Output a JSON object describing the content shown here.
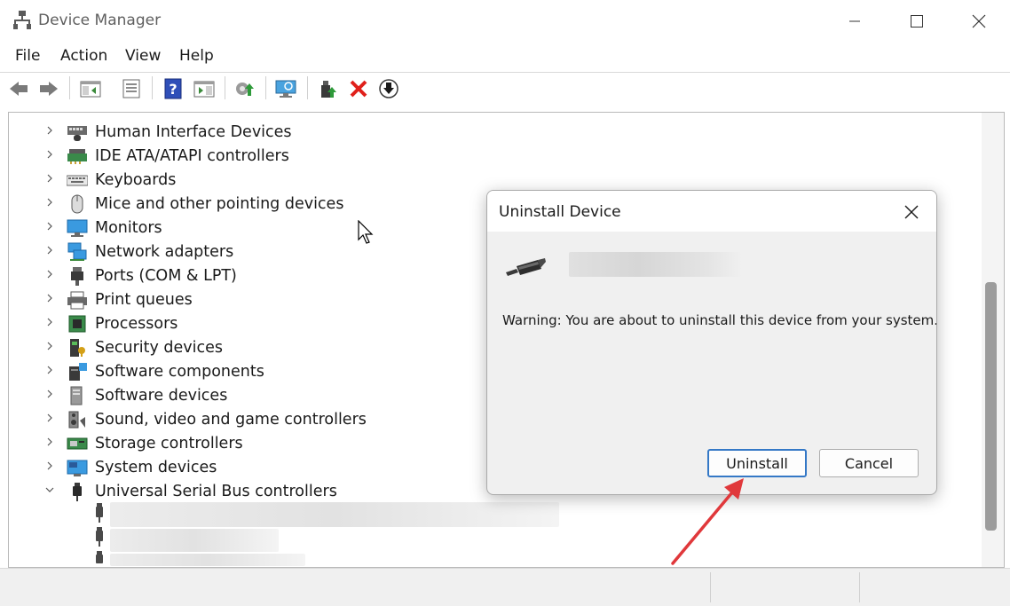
{
  "window": {
    "title": "Device Manager",
    "controls": {
      "minimize": "minimize-icon",
      "maximize": "maximize-icon",
      "close": "close-icon"
    }
  },
  "menu": [
    "File",
    "Action",
    "View",
    "Help"
  ],
  "toolbar": [
    "back-arrow-icon",
    "forward-arrow-icon",
    "show-hide-console-tree-icon",
    "properties-icon",
    "help-icon",
    "action-pane-icon",
    "update-driver-icon",
    "scan-hardware-icon",
    "enable-device-icon",
    "uninstall-device-icon",
    "disable-device-icon"
  ],
  "tree": {
    "items": [
      {
        "label": "Human Interface Devices",
        "icon": "hid-icon",
        "expanded": false
      },
      {
        "label": "IDE ATA/ATAPI controllers",
        "icon": "ide-controller-icon",
        "expanded": false
      },
      {
        "label": "Keyboards",
        "icon": "keyboard-icon",
        "expanded": false
      },
      {
        "label": "Mice and other pointing devices",
        "icon": "mouse-icon",
        "expanded": false
      },
      {
        "label": "Monitors",
        "icon": "monitor-icon",
        "expanded": false
      },
      {
        "label": "Network adapters",
        "icon": "network-adapter-icon",
        "expanded": false
      },
      {
        "label": "Ports (COM & LPT)",
        "icon": "port-icon",
        "expanded": false
      },
      {
        "label": "Print queues",
        "icon": "printer-icon",
        "expanded": false
      },
      {
        "label": "Processors",
        "icon": "processor-icon",
        "expanded": false
      },
      {
        "label": "Security devices",
        "icon": "security-device-icon",
        "expanded": false
      },
      {
        "label": "Software components",
        "icon": "software-component-icon",
        "expanded": false
      },
      {
        "label": "Software devices",
        "icon": "software-device-icon",
        "expanded": false
      },
      {
        "label": "Sound, video and game controllers",
        "icon": "speaker-icon",
        "expanded": false
      },
      {
        "label": "Storage controllers",
        "icon": "storage-controller-icon",
        "expanded": false
      },
      {
        "label": "System devices",
        "icon": "system-device-icon",
        "expanded": false
      },
      {
        "label": "Universal Serial Bus controllers",
        "icon": "usb-icon",
        "expanded": true
      }
    ]
  },
  "dialog": {
    "title": "Uninstall Device",
    "device_icon": "usb-cable-icon",
    "warning": "Warning: You are about to uninstall this device from your system.",
    "uninstall_label": "Uninstall",
    "cancel_label": "Cancel"
  },
  "colors": {
    "accent": "#3478c6",
    "annotation_arrow": "#e0383b",
    "delete_red": "#e0201b"
  }
}
